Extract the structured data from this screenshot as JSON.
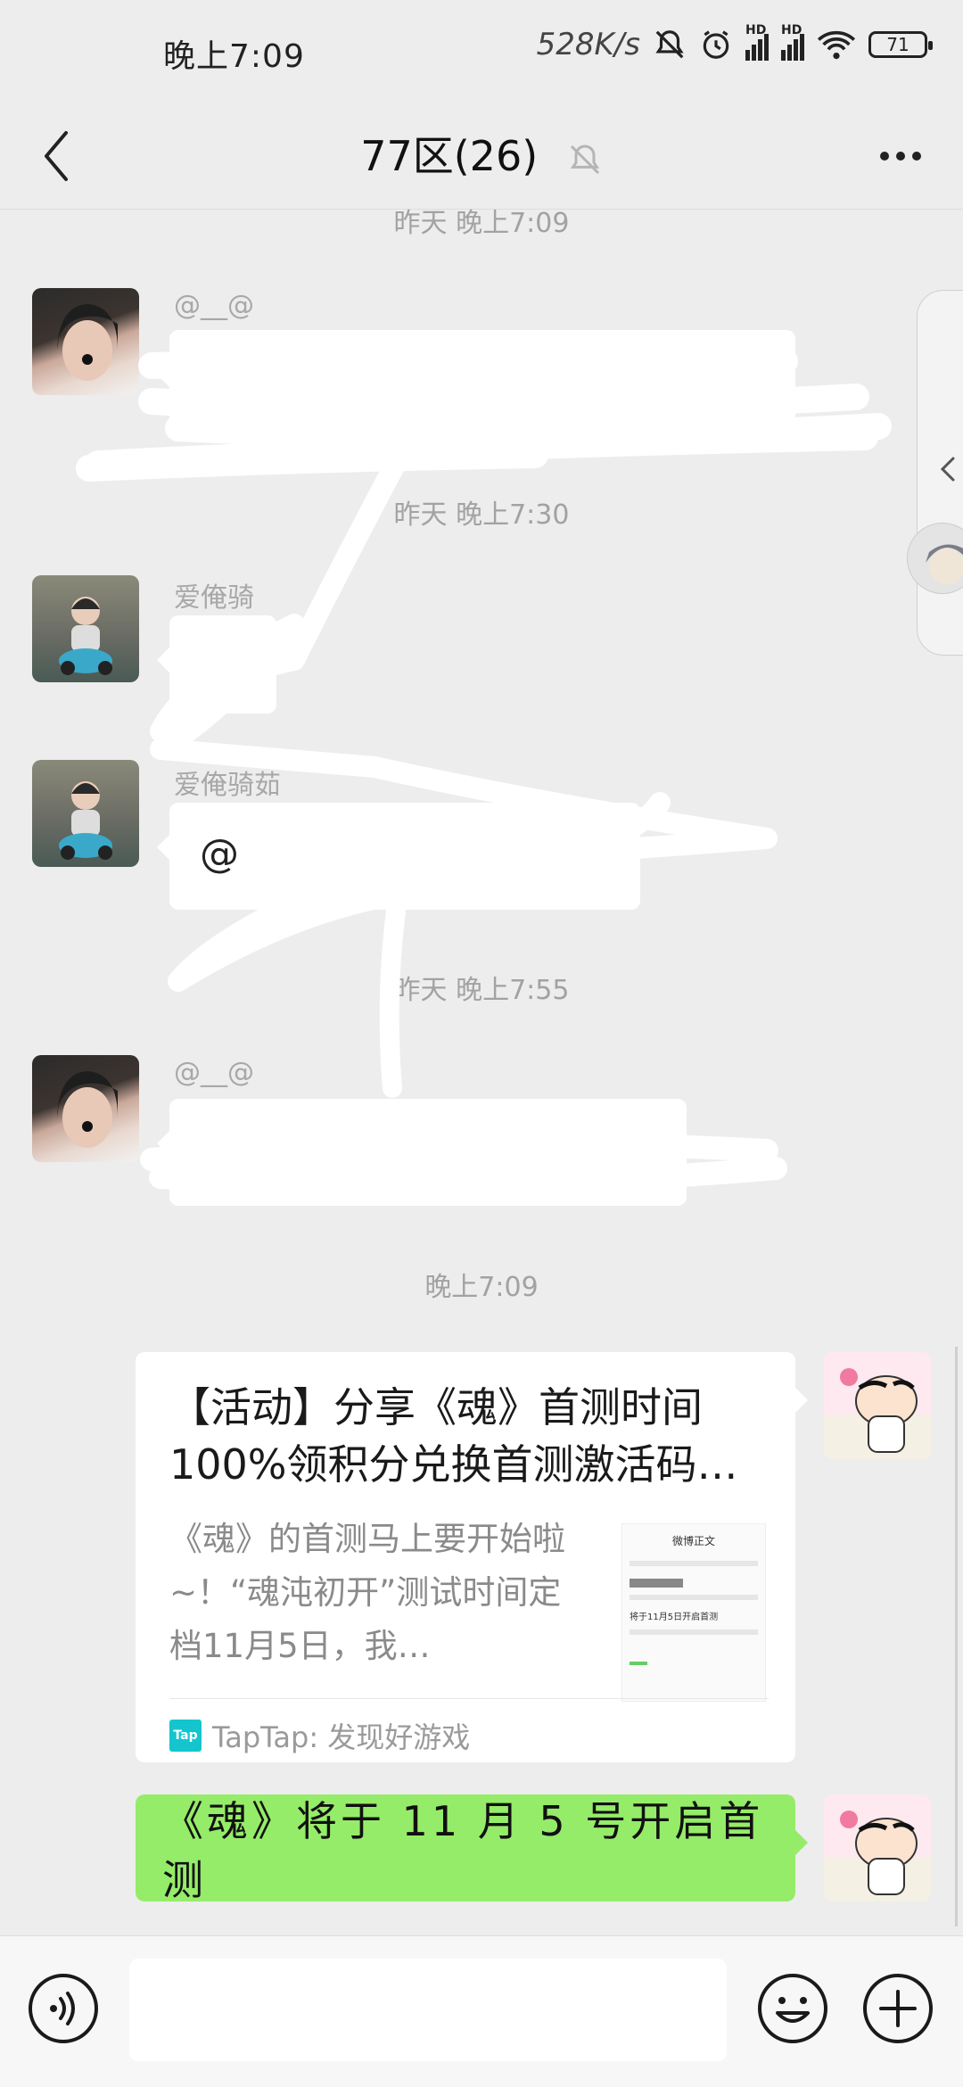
{
  "status": {
    "time": "晚上7:09",
    "speed": "528K/s",
    "network1": "HD",
    "network2": "HD",
    "battery": "71"
  },
  "header": {
    "title": "77区(26)"
  },
  "messages": {
    "ts1": "昨天 晚上7:09",
    "msg1_sender": "@__@",
    "ts2": "昨天 晚上7:30",
    "msg2_sender": "爱俺骑",
    "msg3_sender": "爱俺骑茹",
    "msg3_text": "@",
    "ts3": "昨天 晚上7:55",
    "msg4_sender": "@__@",
    "ts4": "晚上7:09",
    "card": {
      "title": "【活动】分享《魂》首测时间100%领积分兑换首测激活码…",
      "desc": "《魂》的首测马上要开始啦~！“魂沌初开”测试时间定档11月5日，我…",
      "thumb_title": "微博正文",
      "thumb_line": "将于11月5日开启首测",
      "source_logo": "Tap",
      "source": "TapTap: 发现好游戏"
    },
    "last_text": "《魂》将于 11 月 5 号开启首测"
  },
  "icons": {
    "back": "back-arrow-icon",
    "mute": "bell-muted-icon",
    "more": "more-dots-icon",
    "voice": "voice-icon",
    "emoji": "emoji-icon",
    "plus": "plus-icon"
  }
}
